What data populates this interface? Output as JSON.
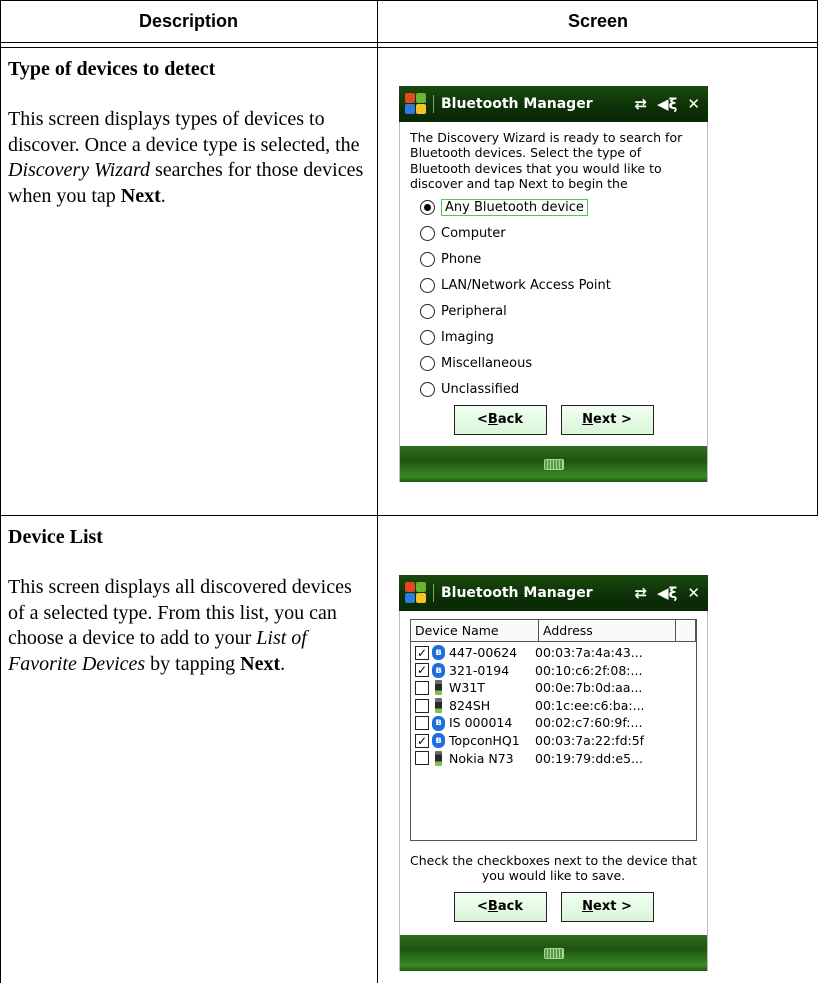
{
  "table": {
    "header_description": "Description",
    "header_screen": "Screen"
  },
  "row1": {
    "title": "Type of devices to detect",
    "text_1": "This screen displays types of devices to discover. Once a device type is selected, the ",
    "text_em": "Discovery Wizard",
    "text_2": " searches for those devices when you tap ",
    "text_bold": "Next",
    "text_3": "."
  },
  "row2": {
    "title": "Device List",
    "text_1": "This screen displays all discovered devices of a selected type. From this list, you can choose a device to add to your ",
    "text_em": "List of Favorite Devices",
    "text_2": " by tapping ",
    "text_bold": "Next",
    "text_3": "."
  },
  "screen1": {
    "title": "Bluetooth Manager",
    "intro": "The Discovery Wizard is ready to search for Bluetooth devices. Select the type of Bluetooth devices that you would like to discover and tap Next to begin the",
    "options": [
      {
        "label": "Any Bluetooth device",
        "selected": true
      },
      {
        "label": "Computer",
        "selected": false
      },
      {
        "label": "Phone",
        "selected": false
      },
      {
        "label": "LAN/Network Access Point",
        "selected": false
      },
      {
        "label": "Peripheral",
        "selected": false
      },
      {
        "label": "Imaging",
        "selected": false
      },
      {
        "label": "Miscellaneous",
        "selected": false
      },
      {
        "label": "Unclassified",
        "selected": false
      }
    ],
    "back_prefix": "< ",
    "back_key": "B",
    "back_rest": "ack",
    "next_key": "N",
    "next_rest": "ext >"
  },
  "screen2": {
    "title": "Bluetooth Manager",
    "col_name": "Device Name",
    "col_address": "Address",
    "devices": [
      {
        "name": "447-00624",
        "address": "00:03:7a:4a:43...",
        "checked": true,
        "icon": "bluetooth-icon"
      },
      {
        "name": "321-0194",
        "address": "00:10:c6:2f:08:...",
        "checked": true,
        "icon": "bluetooth-icon"
      },
      {
        "name": "W31T",
        "address": "00:0e:7b:0d:aa...",
        "checked": false,
        "icon": "phone-icon"
      },
      {
        "name": "824SH",
        "address": "00:1c:ee:c6:ba:...",
        "checked": false,
        "icon": "phone-icon"
      },
      {
        "name": "IS 000014",
        "address": "00:02:c7:60:9f:...",
        "checked": false,
        "icon": "bluetooth-icon"
      },
      {
        "name": "TopconHQ1",
        "address": "00:03:7a:22:fd:5f",
        "checked": true,
        "icon": "bluetooth-icon"
      },
      {
        "name": "Nokia N73",
        "address": "00:19:79:dd:e5...",
        "checked": false,
        "icon": "phone-icon"
      }
    ],
    "note": "Check the checkboxes next to the device that you would like to save.",
    "back_prefix": "< ",
    "back_key": "B",
    "back_rest": "ack",
    "next_key": "N",
    "next_rest": "ext >"
  },
  "glyphs": {
    "connectivity": "⇄",
    "volume": "◀ξ",
    "close": "✕",
    "check": "✓",
    "bluetooth": "ʙ"
  }
}
